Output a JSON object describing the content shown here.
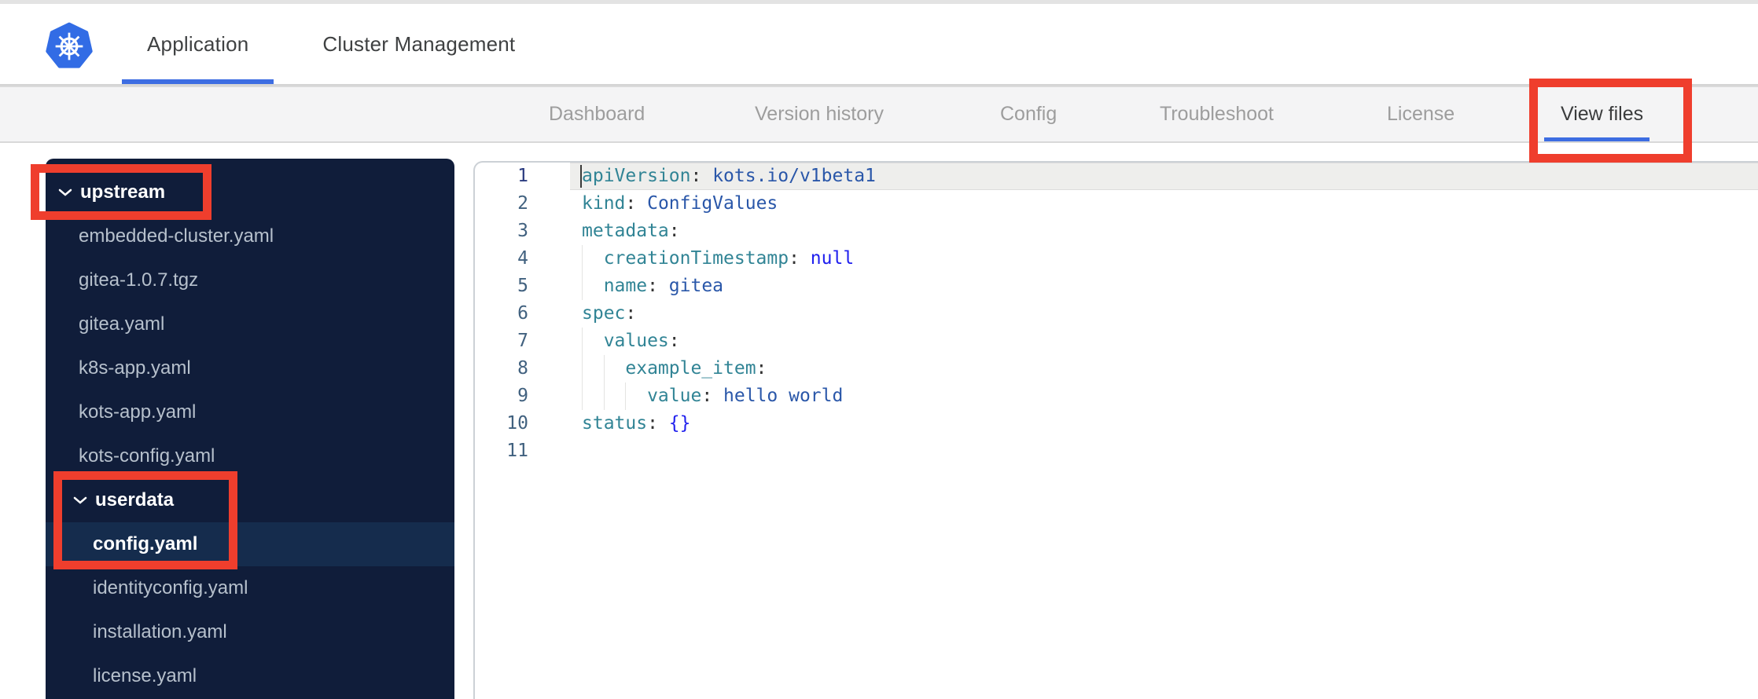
{
  "header": {
    "logo_name": "kubernetes-logo",
    "tabs": [
      {
        "label": "Application",
        "active": true
      },
      {
        "label": "Cluster Management",
        "active": false
      }
    ]
  },
  "subnav": {
    "tabs": [
      {
        "label": "Dashboard",
        "active": false
      },
      {
        "label": "Version history",
        "active": false
      },
      {
        "label": "Config",
        "active": false
      },
      {
        "label": "Troubleshoot",
        "active": false
      },
      {
        "label": "License",
        "active": false
      },
      {
        "label": "View files",
        "active": true
      }
    ]
  },
  "file_tree": {
    "items": [
      {
        "kind": "folder",
        "label": "upstream",
        "level": 0,
        "expanded": true,
        "selected": false
      },
      {
        "kind": "file",
        "label": "embedded-cluster.yaml",
        "level": 1,
        "selected": false
      },
      {
        "kind": "file",
        "label": "gitea-1.0.7.tgz",
        "level": 1,
        "selected": false
      },
      {
        "kind": "file",
        "label": "gitea.yaml",
        "level": 1,
        "selected": false
      },
      {
        "kind": "file",
        "label": "k8s-app.yaml",
        "level": 1,
        "selected": false
      },
      {
        "kind": "file",
        "label": "kots-app.yaml",
        "level": 1,
        "selected": false
      },
      {
        "kind": "file",
        "label": "kots-config.yaml",
        "level": 1,
        "selected": false
      },
      {
        "kind": "folder",
        "label": "userdata",
        "level": 1,
        "expanded": true,
        "selected": false
      },
      {
        "kind": "file",
        "label": "config.yaml",
        "level": 2,
        "selected": true
      },
      {
        "kind": "file",
        "label": "identityconfig.yaml",
        "level": 2,
        "selected": false
      },
      {
        "kind": "file",
        "label": "installation.yaml",
        "level": 2,
        "selected": false
      },
      {
        "kind": "file",
        "label": "license.yaml",
        "level": 2,
        "selected": false
      }
    ]
  },
  "editor": {
    "language": "yaml",
    "active_line": 1,
    "lines": [
      {
        "num": 1,
        "indent": 0,
        "tokens": [
          [
            "key",
            "apiVersion"
          ],
          [
            "punc",
            ": "
          ],
          [
            "str",
            "kots.io/v1beta1"
          ]
        ]
      },
      {
        "num": 2,
        "indent": 0,
        "tokens": [
          [
            "key",
            "kind"
          ],
          [
            "punc",
            ": "
          ],
          [
            "str",
            "ConfigValues"
          ]
        ]
      },
      {
        "num": 3,
        "indent": 0,
        "tokens": [
          [
            "key",
            "metadata"
          ],
          [
            "punc",
            ":"
          ]
        ]
      },
      {
        "num": 4,
        "indent": 2,
        "tokens": [
          [
            "key",
            "creationTimestamp"
          ],
          [
            "punc",
            ": "
          ],
          [
            "const",
            "null"
          ]
        ]
      },
      {
        "num": 5,
        "indent": 2,
        "tokens": [
          [
            "key",
            "name"
          ],
          [
            "punc",
            ": "
          ],
          [
            "str",
            "gitea"
          ]
        ]
      },
      {
        "num": 6,
        "indent": 0,
        "tokens": [
          [
            "key",
            "spec"
          ],
          [
            "punc",
            ":"
          ]
        ]
      },
      {
        "num": 7,
        "indent": 2,
        "tokens": [
          [
            "key",
            "values"
          ],
          [
            "punc",
            ":"
          ]
        ]
      },
      {
        "num": 8,
        "indent": 4,
        "tokens": [
          [
            "key",
            "example_item"
          ],
          [
            "punc",
            ":"
          ]
        ]
      },
      {
        "num": 9,
        "indent": 6,
        "tokens": [
          [
            "key",
            "value"
          ],
          [
            "punc",
            ": "
          ],
          [
            "str",
            "hello world"
          ]
        ]
      },
      {
        "num": 10,
        "indent": 0,
        "tokens": [
          [
            "key",
            "status"
          ],
          [
            "punc",
            ": "
          ],
          [
            "const",
            "{}"
          ]
        ]
      },
      {
        "num": 11,
        "indent": 0,
        "tokens": []
      }
    ]
  },
  "annotations": {
    "color": "#ef3e2d",
    "boxes": [
      {
        "target": "upstream-folder"
      },
      {
        "target": "userdata-config-selection"
      },
      {
        "target": "view-files-tab"
      }
    ]
  },
  "colors": {
    "accent_blue": "#3d6de2",
    "logo_blue": "#326ce5",
    "sidebar_bg": "#101d3a",
    "sidebar_selected_bg": "#152c4d",
    "annotation_red": "#ef3e2d",
    "code_key": "#318495",
    "code_string": "#2a57a9",
    "code_constant": "#2020ee"
  }
}
